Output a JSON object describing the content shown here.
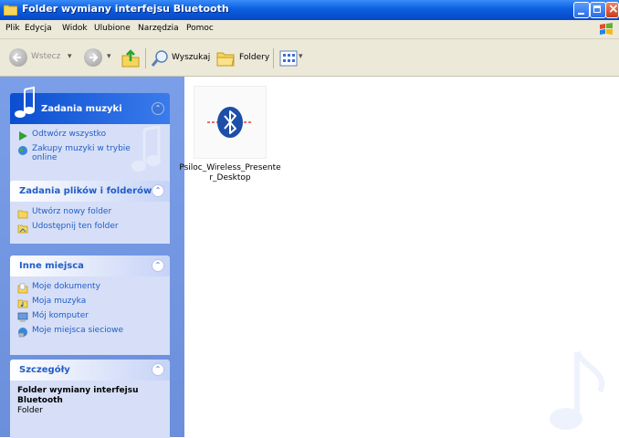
{
  "window": {
    "title": "Folder wymiany interfejsu Bluetooth"
  },
  "menu": [
    "Plik",
    "Edycja",
    "Widok",
    "Ulubione",
    "Narzędzia",
    "Pomoc"
  ],
  "toolbar": {
    "back_label": "Wstecz",
    "search_label": "Wyszukaj",
    "folders_label": "Foldery"
  },
  "panels": {
    "music": {
      "title": "Zadania muzyki",
      "items": [
        "Odtwórz wszystko",
        "Zakupy muzyki w trybie",
        "online"
      ]
    },
    "files": {
      "title": "Zadania plików i folderów",
      "items": [
        "Utwórz nowy folder",
        "Udostępnij ten folder"
      ]
    },
    "places": {
      "title": "Inne miejsca",
      "items": [
        "Moje dokumenty",
        "Moja muzyka",
        "Mój komputer",
        "Moje miejsca sieciowe"
      ]
    },
    "details": {
      "title": "Szczegóły",
      "name": "Folder wymiany interfejsu Bluetooth",
      "type": "Folder"
    }
  },
  "files": [
    {
      "name": "Psiloc_Wireless_Presente​r_Desktop",
      "icon": "bluetooth-icon"
    }
  ],
  "colors": {
    "titlebar": "#0a5fe0",
    "panel_bg": "#6c8fdb",
    "link": "#215dc6"
  }
}
